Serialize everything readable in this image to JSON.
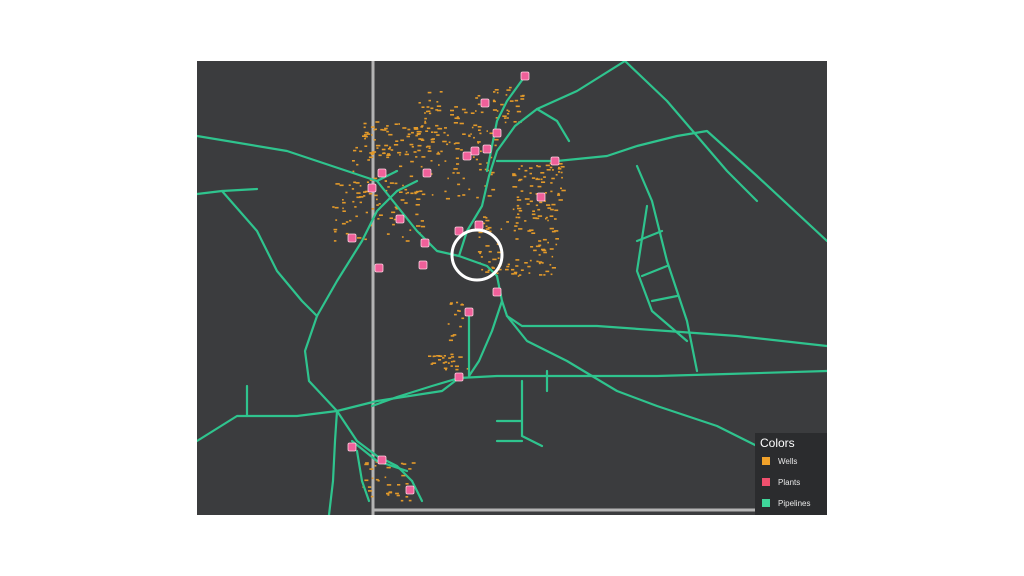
{
  "legend": {
    "title": "Colors",
    "items": [
      {
        "label": "Wells",
        "color": "#f0a12a"
      },
      {
        "label": "Plants",
        "color": "#f0506e"
      },
      {
        "label": "Pipelines",
        "color": "#3fd69a"
      }
    ]
  },
  "colors": {
    "background": "#3b3c3e",
    "pipeline": "#2fc48e",
    "well": "#e39a2a",
    "plant": "#f0609a",
    "boundary": "#b4b4b4",
    "highlight": "#ffffff"
  }
}
